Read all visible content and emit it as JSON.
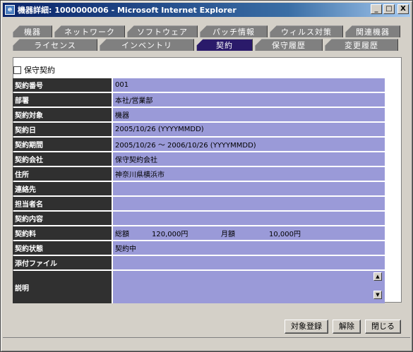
{
  "window": {
    "title": "機器詳細: 1000000006 - Microsoft Internet Explorer",
    "icon": "ie-icon",
    "minimize": "_",
    "maximize": "□",
    "close": "X"
  },
  "tabs_row1": [
    "機器",
    "ネットワーク",
    "ソフトウェア",
    "パッチ情報",
    "ウィルス対策",
    "関連機器"
  ],
  "tabs_row2": [
    "ライセンス",
    "インベントリ",
    "契約",
    "保守履歴",
    "変更履歴"
  ],
  "active_tab": "契約",
  "checkbox_label": "保守契約",
  "rows": [
    {
      "label": "契約番号",
      "value": "001"
    },
    {
      "label": "部署",
      "value": "本社/営業部"
    },
    {
      "label": "契約対象",
      "value": "機器"
    },
    {
      "label": "契約日",
      "value": "2005/10/26 (YYYYMMDD)"
    },
    {
      "label": "契約期間",
      "value": "2005/10/26 ～ 2006/10/26 (YYYYMMDD)"
    },
    {
      "label": "契約会社",
      "value": "保守契約会社"
    },
    {
      "label": "住所",
      "value": "神奈川県横浜市"
    },
    {
      "label": "連絡先",
      "value": ""
    },
    {
      "label": "担当者名",
      "value": ""
    },
    {
      "label": "契約内容",
      "value": ""
    }
  ],
  "fee": {
    "label": "契約料",
    "total_label": "総額",
    "total": "120,000円",
    "monthly_label": "月額",
    "monthly": "10,000円"
  },
  "rows_after": [
    {
      "label": "契約状態",
      "value": "契約中"
    },
    {
      "label": "添付ファイル",
      "value": ""
    }
  ],
  "description": {
    "label": "説明",
    "value": ""
  },
  "buttons": {
    "register": "対象登録",
    "delete": "解除",
    "close": "閉じる"
  }
}
